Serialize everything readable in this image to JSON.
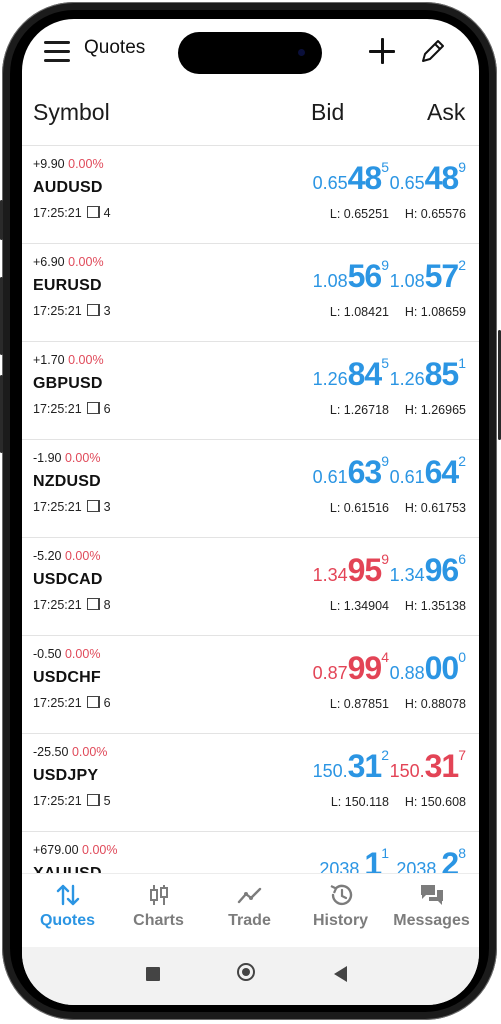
{
  "header": {
    "title": "Quotes"
  },
  "columns": {
    "symbol": "Symbol",
    "bid": "Bid",
    "ask": "Ask"
  },
  "quotes": [
    {
      "change": "+9.90",
      "pct": "0.00%",
      "symbol": "AUDUSD",
      "time": "17:25:21",
      "spread": "4",
      "bid": {
        "pre": "0.65",
        "big": "48",
        "sup": "5",
        "color": "blue"
      },
      "ask": {
        "pre": "0.65",
        "big": "48",
        "sup": "9",
        "color": "blue"
      },
      "low": "L: 0.65251",
      "high": "H: 0.65576"
    },
    {
      "change": "+6.90",
      "pct": "0.00%",
      "symbol": "EURUSD",
      "time": "17:25:21",
      "spread": "3",
      "bid": {
        "pre": "1.08",
        "big": "56",
        "sup": "9",
        "color": "blue"
      },
      "ask": {
        "pre": "1.08",
        "big": "57",
        "sup": "2",
        "color": "blue"
      },
      "low": "L: 1.08421",
      "high": "H: 1.08659"
    },
    {
      "change": "+1.70",
      "pct": "0.00%",
      "symbol": "GBPUSD",
      "time": "17:25:21",
      "spread": "6",
      "bid": {
        "pre": "1.26",
        "big": "84",
        "sup": "5",
        "color": "blue"
      },
      "ask": {
        "pre": "1.26",
        "big": "85",
        "sup": "1",
        "color": "blue"
      },
      "low": "L: 1.26718",
      "high": "H: 1.26965"
    },
    {
      "change": "-1.90",
      "pct": "0.00%",
      "symbol": "NZDUSD",
      "time": "17:25:21",
      "spread": "3",
      "bid": {
        "pre": "0.61",
        "big": "63",
        "sup": "9",
        "color": "blue"
      },
      "ask": {
        "pre": "0.61",
        "big": "64",
        "sup": "2",
        "color": "blue"
      },
      "low": "L: 0.61516",
      "high": "H: 0.61753"
    },
    {
      "change": "-5.20",
      "pct": "0.00%",
      "symbol": "USDCAD",
      "time": "17:25:21",
      "spread": "8",
      "bid": {
        "pre": "1.34",
        "big": "95",
        "sup": "9",
        "color": "red"
      },
      "ask": {
        "pre": "1.34",
        "big": "96",
        "sup": "6",
        "color": "blue"
      },
      "low": "L: 1.34904",
      "high": "H: 1.35138"
    },
    {
      "change": "-0.50",
      "pct": "0.00%",
      "symbol": "USDCHF",
      "time": "17:25:21",
      "spread": "6",
      "bid": {
        "pre": "0.87",
        "big": "99",
        "sup": "4",
        "color": "red"
      },
      "ask": {
        "pre": "0.88",
        "big": "00",
        "sup": "0",
        "color": "blue"
      },
      "low": "L: 0.87851",
      "high": "H: 0.88078"
    },
    {
      "change": "-25.50",
      "pct": "0.00%",
      "symbol": "USDJPY",
      "time": "17:25:21",
      "spread": "5",
      "bid": {
        "pre": "150.",
        "big": "31",
        "sup": "2",
        "color": "blue"
      },
      "ask": {
        "pre": "150.",
        "big": "31",
        "sup": "7",
        "color": "red"
      },
      "low": "L: 150.118",
      "high": "H: 150.608"
    },
    {
      "change": "+679.00",
      "pct": "0.00%",
      "symbol": "XAUUSD",
      "time": "",
      "spread": "",
      "bid": {
        "pre": "2038.",
        "big": "1",
        "sup": "1",
        "color": "blue"
      },
      "ask": {
        "pre": "2038.",
        "big": "2",
        "sup": "8",
        "color": "blue"
      },
      "low": "",
      "high": ""
    }
  ],
  "tabs": [
    {
      "label": "Quotes",
      "icon": "quotes-arrows-icon",
      "active": true
    },
    {
      "label": "Charts",
      "icon": "candlestick-icon",
      "active": false
    },
    {
      "label": "Trade",
      "icon": "trend-line-icon",
      "active": false
    },
    {
      "label": "History",
      "icon": "history-clock-icon",
      "active": false
    },
    {
      "label": "Messages",
      "icon": "chat-bubbles-icon",
      "active": false
    }
  ],
  "colors": {
    "blue": "#2b95e3",
    "red": "#e34456",
    "active_tab": "#2b95e3",
    "inactive_tab": "#7c7c7c"
  }
}
